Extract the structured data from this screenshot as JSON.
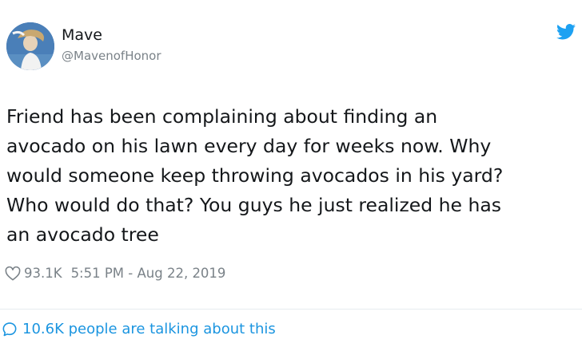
{
  "tweet": {
    "display_name": "Mave",
    "handle": "@MavenofHonor",
    "text_lines": [
      "Friend has been complaining about finding an",
      "avocado on his lawn every day for weeks now. Why",
      "would someone keep throwing avocados in his yard?",
      "Who would do that? You guys he just realized he has",
      "an avocado tree"
    ],
    "likes": "93.1K",
    "timestamp": "5:51 PM - Aug 22, 2019",
    "talking": "10.6K people are talking about this"
  },
  "icons": {
    "brand": "twitter-bird-icon",
    "like": "heart-icon",
    "conversation": "speech-bubble-icon"
  },
  "colors": {
    "link": "#1b95e0",
    "secondary_text": "#7a8288",
    "primary_text": "#14171a"
  }
}
